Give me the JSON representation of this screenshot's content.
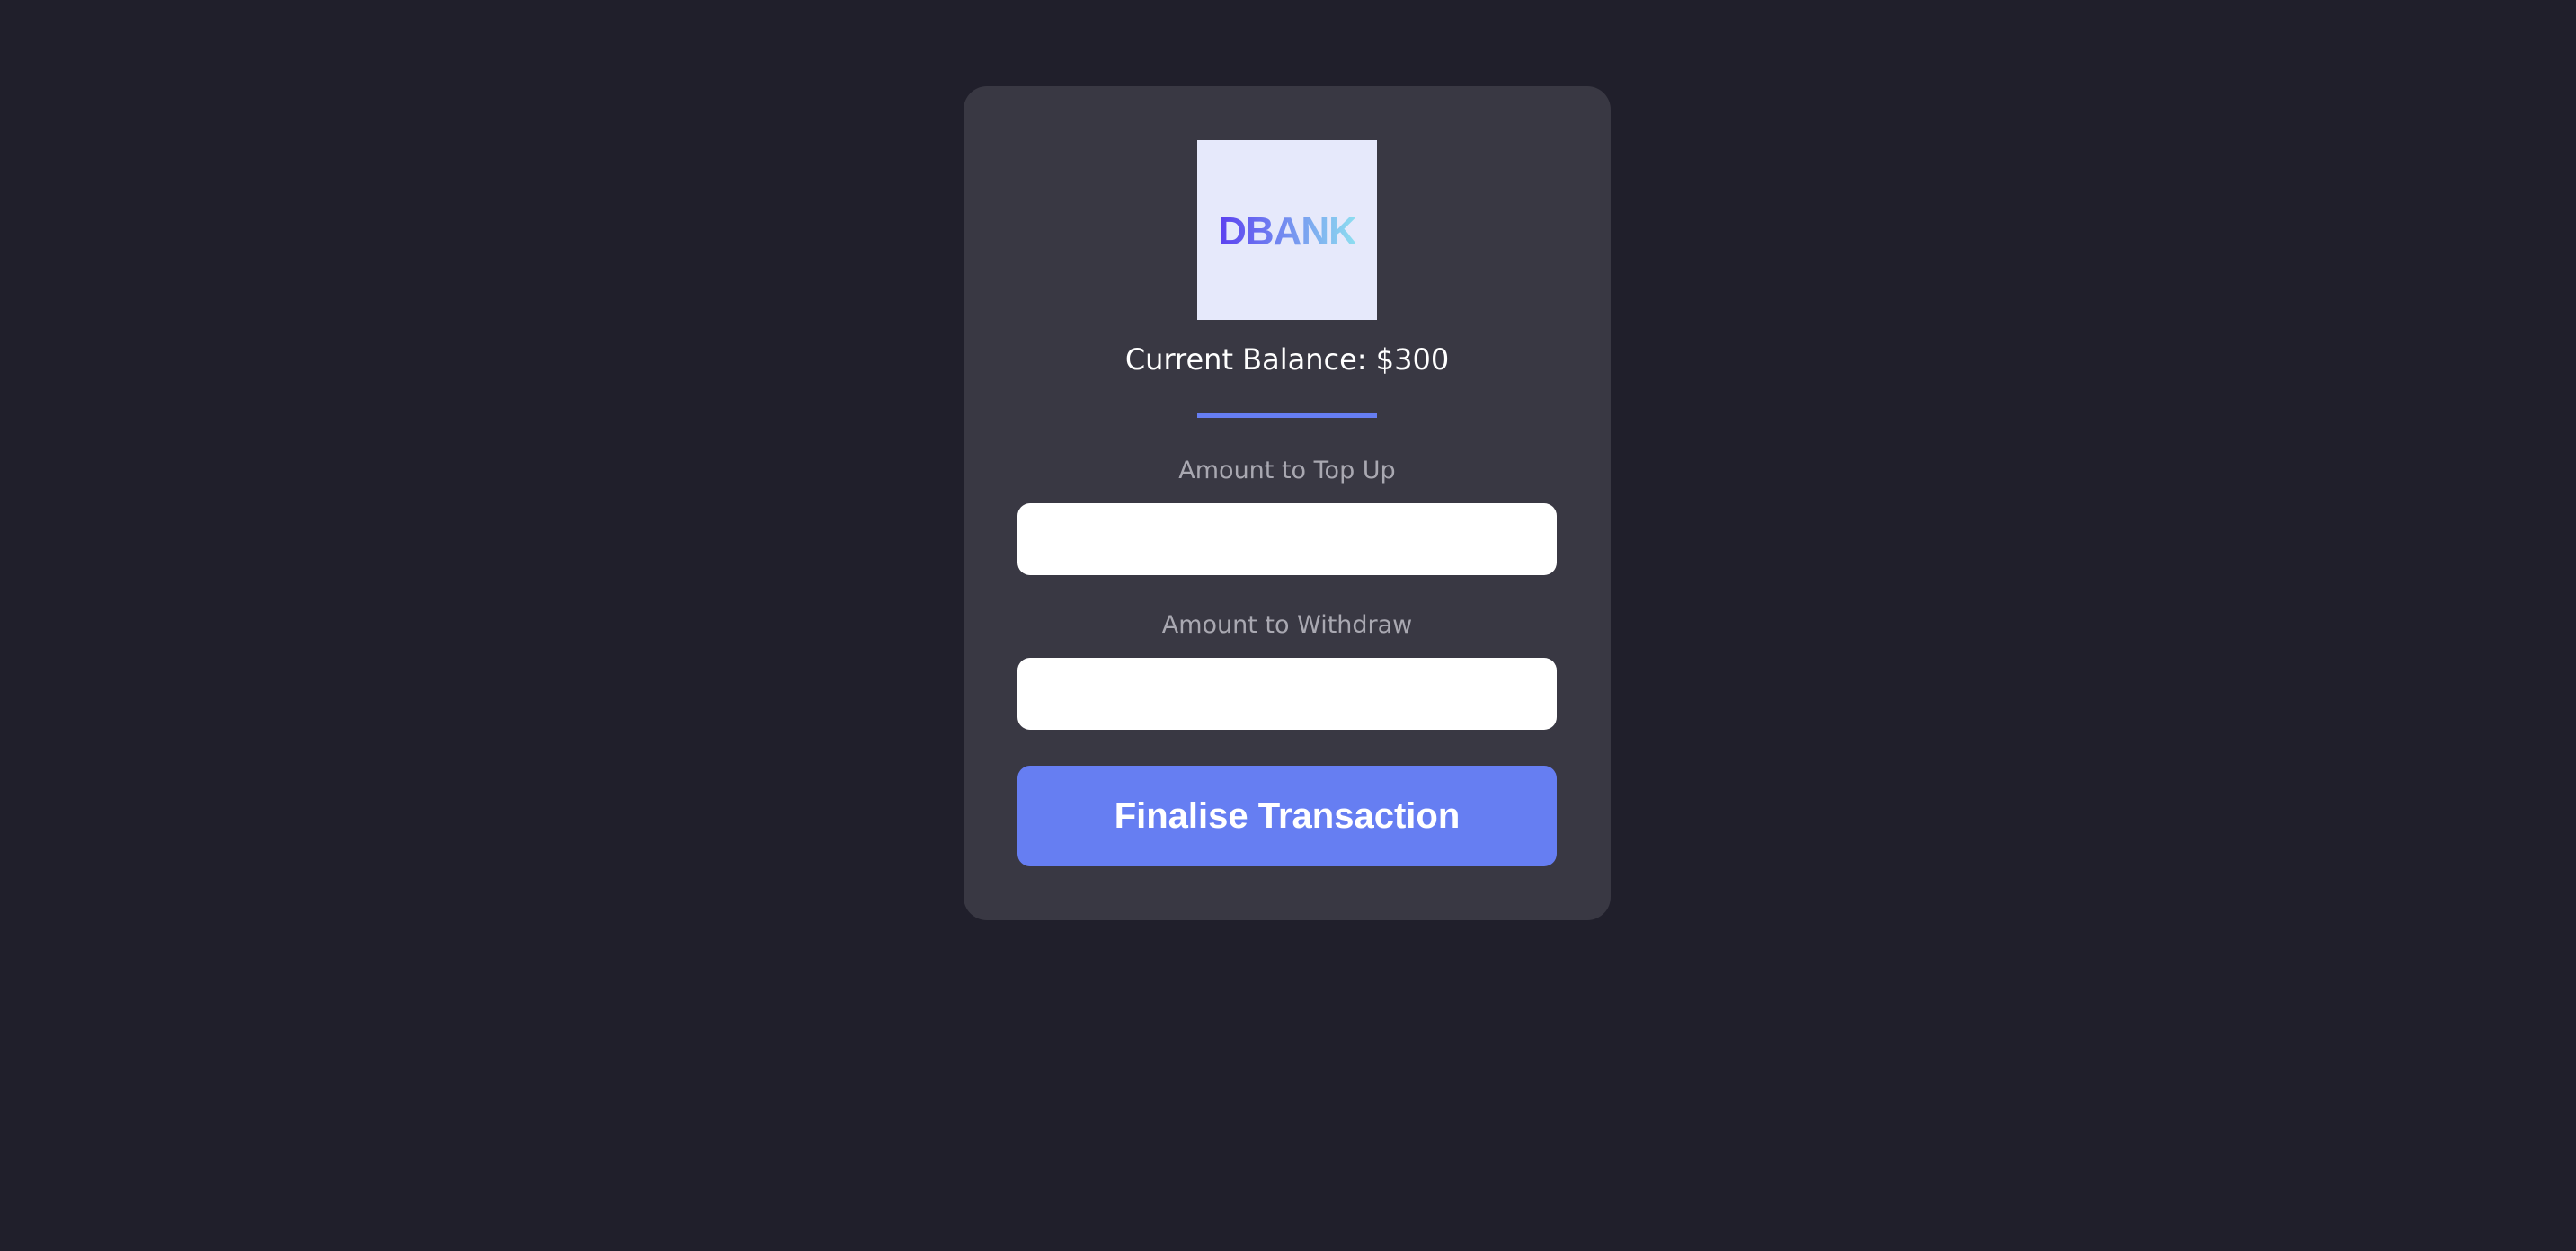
{
  "logo": {
    "text": "DBANK",
    "gradient_start": "#5b3ff0",
    "gradient_end": "#8ee0f0",
    "background": "#e6e9fb"
  },
  "balance": {
    "label": "Current Balance: $300"
  },
  "topup": {
    "label": "Amount to Top Up",
    "value": "",
    "placeholder": ""
  },
  "withdraw": {
    "label": "Amount to Withdraw",
    "value": "",
    "placeholder": ""
  },
  "actions": {
    "finalise_label": "Finalise Transaction"
  },
  "colors": {
    "page_background": "#201f2b",
    "card_background": "#393843",
    "accent": "#667ef2",
    "label_text": "#a9a8b1"
  }
}
